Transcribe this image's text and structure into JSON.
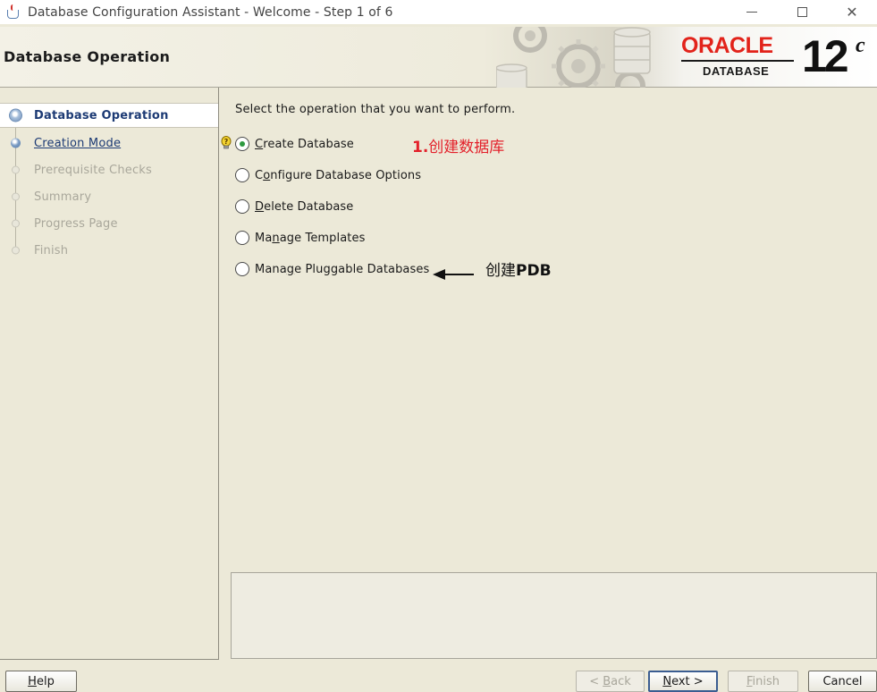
{
  "window": {
    "title": "Database Configuration Assistant - Welcome - Step 1 of 6",
    "min_glyph": "",
    "close_glyph": "✕"
  },
  "header": {
    "title": "Database Operation",
    "logo_brand": "ORACLE",
    "logo_product": "DATABASE",
    "version_number": "12",
    "version_letter": "c"
  },
  "nav": {
    "items": [
      {
        "label": "Database Operation",
        "state": "current"
      },
      {
        "label": "Creation Mode",
        "state": "link"
      },
      {
        "label": "Prerequisite Checks",
        "state": "disabled"
      },
      {
        "label": "Summary",
        "state": "disabled"
      },
      {
        "label": "Progress Page",
        "state": "disabled"
      },
      {
        "label": "Finish",
        "state": "disabled"
      }
    ]
  },
  "main": {
    "instruction": "Select the operation that you want to perform.",
    "options": [
      {
        "label": "Create Database",
        "mnemonic_index": 0,
        "checked": true
      },
      {
        "label": "Configure Database Options",
        "mnemonic_index": 1,
        "checked": false
      },
      {
        "label": "Delete Database",
        "mnemonic_index": 0,
        "checked": false
      },
      {
        "label": "Manage Templates",
        "mnemonic_index": 2,
        "checked": false
      },
      {
        "label": "Manage Pluggable Databases",
        "mnemonic_index": 4,
        "checked": false
      }
    ],
    "annotation_create_num": "1.",
    "annotation_create_text": "创建数据库",
    "annotation_pdb_text": "创建",
    "annotation_pdb_bold": "PDB"
  },
  "buttons": {
    "help": "Help",
    "back": "< Back",
    "next": "Next >",
    "finish": "Finish",
    "cancel": "Cancel"
  },
  "colors": {
    "background": "#ece9d8",
    "oracle_red": "#e2231a",
    "nav_link": "#1c3a74",
    "annotation_red": "#e3202a",
    "radio_checked": "#2f9a40"
  }
}
